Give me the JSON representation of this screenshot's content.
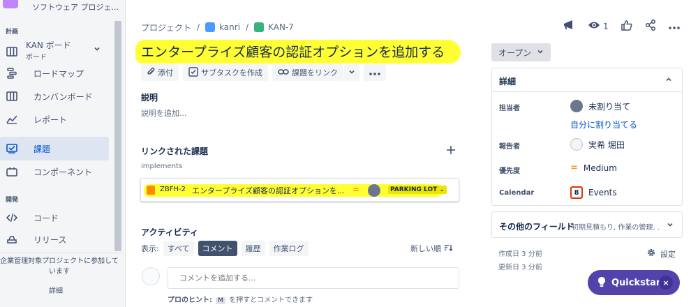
{
  "sidebar": {
    "project_name": "ソフトウェア プロジェ...",
    "section_plan": "計画",
    "board": {
      "label": "KAN ボード",
      "sub": "ボード"
    },
    "items": [
      {
        "label": "ロードマップ",
        "icon": "roadmap-icon"
      },
      {
        "label": "カンバンボード",
        "icon": "board-icon"
      },
      {
        "label": "レポート",
        "icon": "report-icon"
      },
      {
        "label": "課題",
        "icon": "issues-icon",
        "active": true
      },
      {
        "label": "コンポーネント",
        "icon": "component-icon"
      }
    ],
    "section_dev": "開発",
    "dev_items": [
      {
        "label": "コード",
        "icon": "code-icon"
      },
      {
        "label": "リリース",
        "icon": "release-icon"
      }
    ],
    "note": "企業管理対象プロジェクトに参加しています",
    "detail": "詳細"
  },
  "breadcrumb": {
    "root": "プロジェクト",
    "project": "kanri",
    "issue": "KAN-7"
  },
  "header": {
    "watchers": "1"
  },
  "issue": {
    "title": "エンタープライズ顧客の認証オプションを追加する"
  },
  "toolbar": {
    "attach": "添付",
    "subtask": "サブタスクを作成",
    "link": "課題をリンク"
  },
  "description": {
    "heading": "説明",
    "placeholder": "説明を追加..."
  },
  "linked": {
    "heading": "リンクされた課題",
    "type": "implements",
    "item": {
      "key": "ZBFH-2",
      "summary": "エンタープライズ顧客の認証オプションを...",
      "priority": "=",
      "status": "PARKING LOT"
    }
  },
  "activity": {
    "heading": "アクティビティ",
    "show_label": "表示:",
    "filters": [
      "すべて",
      "コメント",
      "履歴",
      "作業ログ"
    ],
    "active_filter": "コメント",
    "sort": "新しい順",
    "comment_placeholder": "コメントを追加する...",
    "protip_bold": "プロのヒント:",
    "protip_key": "M",
    "protip_text": "を押すとコメントできます"
  },
  "status": {
    "label": "オープン"
  },
  "details": {
    "heading": "詳細",
    "assignee_label": "担当者",
    "assignee_value": "未割り当て",
    "assign_me": "自分に割り当てる",
    "reporter_label": "報告者",
    "reporter_value": "実希 堀田",
    "priority_label": "優先度",
    "priority_value": "Medium",
    "calendar_label": "Calendar",
    "calendar_day": "8",
    "calendar_value": "Events"
  },
  "other_fields": {
    "heading": "その他のフィールド",
    "summary": "初期見積もり, 作業の管理, ..."
  },
  "meta": {
    "created": "作成日 3 分前",
    "updated": "更新日 3 分前",
    "settings": "設定"
  },
  "quickstart": {
    "label": "Quickstart"
  },
  "colors": {
    "accent": "#0052cc",
    "highlight": "#ffff33",
    "quickstart": "#5243aa"
  }
}
